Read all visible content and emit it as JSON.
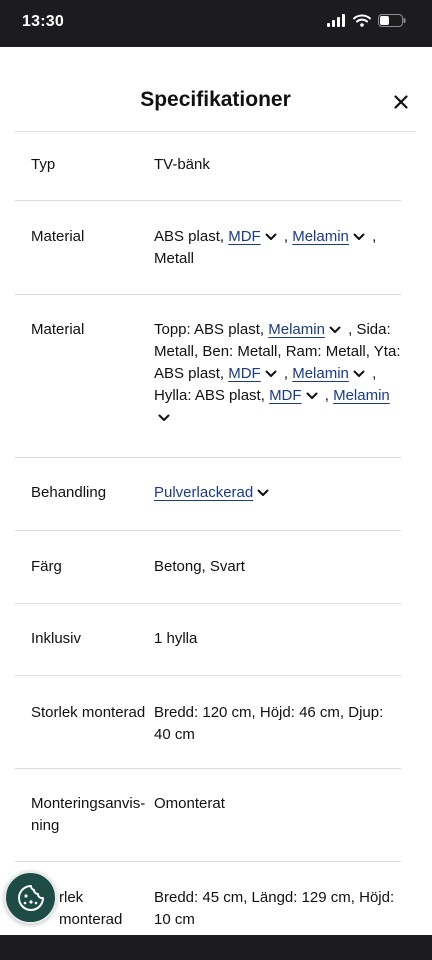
{
  "status": {
    "time": "13:30"
  },
  "header": {
    "title": "Specifikationer"
  },
  "rows": [
    {
      "label": "Typ",
      "value": "TV-bänk"
    },
    {
      "label": "Material",
      "parts": [
        "ABS plast, ",
        "MDF",
        " , ",
        "Melamin",
        " , Metall"
      ]
    },
    {
      "label": "Material",
      "parts": [
        "Topp: ABS plast, ",
        "Melamin",
        " , Sida: Metall, Ben: Metall, Ram: Metall, Yta: ABS plast, ",
        "MDF",
        " , ",
        "Melamin",
        " , Hylla: ABS plast, ",
        "MDF",
        " , ",
        "Melamin"
      ]
    },
    {
      "label": "Behandling",
      "parts": [
        "Pulverlackerad"
      ]
    },
    {
      "label": "Färg",
      "value": "Betong, Svart"
    },
    {
      "label": "Inklusiv",
      "value": "1 hylla"
    },
    {
      "label": "Storlek monterad",
      "value": "Bredd: 120 cm, Höjd: 46 cm, Djup: 40 cm"
    },
    {
      "label_lines": [
        "Monteringsanvis-",
        "ning"
      ],
      "value": "Omonterat"
    },
    {
      "label_lines": [
        "rlek",
        "monterad"
      ],
      "value_lines": [
        "Bredd: 45 cm, Längd: 129 cm, Höjd:",
        "10 cm"
      ]
    }
  ],
  "colors": {
    "link": "#1a3a8c",
    "cookie_button": "#1d4b45",
    "status_bar": "#1c1c1e"
  },
  "icons": {
    "close": "close-icon",
    "chevron": "chevron-down-icon",
    "cookie": "cookie-icon"
  }
}
